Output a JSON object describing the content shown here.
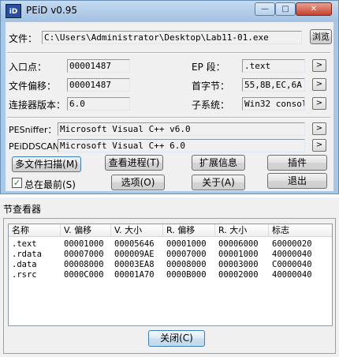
{
  "window": {
    "title": "PEiD v0.95",
    "icon_text": "iD",
    "min_glyph": "—",
    "max_glyph": "□",
    "close_glyph": "✕"
  },
  "file": {
    "label": "文件：",
    "path": "C:\\Users\\Administrator\\Desktop\\Lab11-01.exe",
    "browse_label": "浏览"
  },
  "info": {
    "entry_point_label": "入口点：",
    "entry_point": "00001487",
    "file_offset_label": "文件偏移：",
    "file_offset": "00001487",
    "linker_label": "连接器版本：",
    "linker": "6.0",
    "ep_section_label": "EP 段：",
    "ep_section": ".text",
    "first_bytes_label": "首字节：",
    "first_bytes": "55,8B,EC,6A",
    "subsystem_label": "子系统：",
    "subsystem": "Win32 console",
    "arrow_glyph": ">"
  },
  "scan": {
    "pesniffer_label": "PESniffer：",
    "pesniffer": "Microsoft Visual C++ v6.0",
    "peiddscan_label": "PEiDDSCAN：",
    "peiddscan": "Microsoft Visual C++ 6.0"
  },
  "buttons": {
    "multi_scan": "多文件扫描(M)",
    "view_process": "查看进程(T)",
    "extensions": "扩展信息",
    "plugins": "插件",
    "options": "选项(O)",
    "about": "关于(A)",
    "exit": "退出"
  },
  "always_on_top": {
    "label": "总在最前(S)",
    "checked_glyph": "✓"
  },
  "section_viewer": {
    "title": "节查看器",
    "columns": [
      "名称",
      "V. 偏移",
      "V. 大小",
      "R. 偏移",
      "R. 大小",
      "标志"
    ],
    "rows": [
      [
        ".text",
        "00001000",
        "00005646",
        "00001000",
        "00006000",
        "60000020"
      ],
      [
        ".rdata",
        "00007000",
        "000009AE",
        "00007000",
        "00001000",
        "40000040"
      ],
      [
        ".data",
        "00008000",
        "00003EA8",
        "00008000",
        "00003000",
        "C0000040"
      ],
      [
        ".rsrc",
        "0000C000",
        "00001A70",
        "0000B000",
        "00002000",
        "40000040"
      ]
    ],
    "close_label": "关闭(C)"
  }
}
